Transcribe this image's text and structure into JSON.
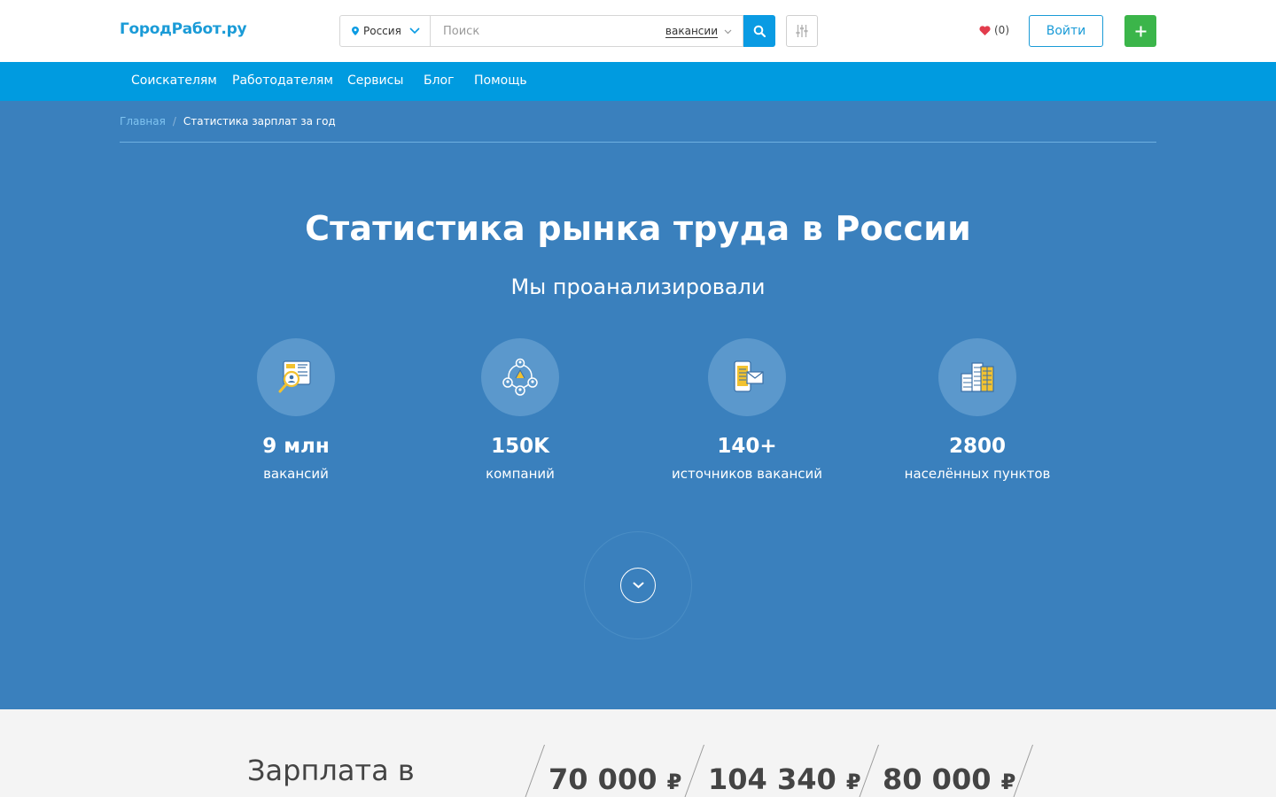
{
  "header": {
    "logo": "ГородРабот.ру",
    "region": "Россия",
    "search_placeholder": "Поиск",
    "search_type": "вакансии",
    "favorites": "(0)",
    "login": "Войти"
  },
  "nav": [
    "Соискателям",
    "Работодателям",
    "Сервисы",
    "Блог",
    "Помощь"
  ],
  "breadcrumbs": {
    "home": "Главная",
    "separator": "/",
    "current": "Статистика зарплат за год"
  },
  "hero": {
    "title": "Статистика рынка труда в России",
    "subtitle": "Мы проанализировали",
    "stats": [
      {
        "icon": "vacancy-search-icon",
        "value": "9 млн",
        "label": "вакансий"
      },
      {
        "icon": "companies-network-icon",
        "value": "150K",
        "label": "компаний"
      },
      {
        "icon": "sources-devices-icon",
        "value": "140+",
        "label": "источников вакансий"
      },
      {
        "icon": "city-buildings-icon",
        "value": "2800",
        "label": "населённых пунктов"
      }
    ]
  },
  "salary": {
    "title": "Зарплата в",
    "values": [
      {
        "amount": "70 000",
        "currency": "₽"
      },
      {
        "amount": "104 340",
        "currency": "₽"
      },
      {
        "amount": "80 000",
        "currency": "₽"
      }
    ]
  },
  "colors": {
    "brand": "#1a9bd7",
    "nav_bg": "#009be0",
    "hero_bg": "#3a80bd",
    "add_button": "#3bb54a",
    "heart": "#e23c4c"
  }
}
